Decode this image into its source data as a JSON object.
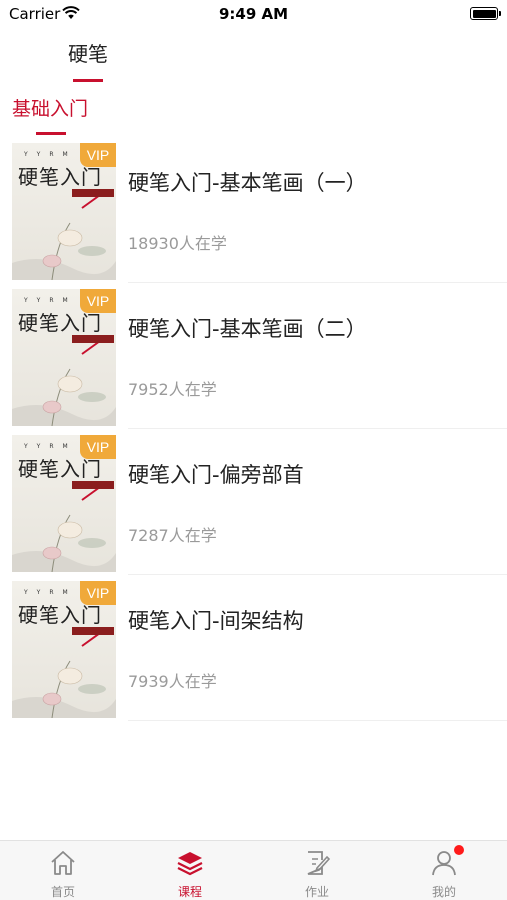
{
  "status_bar": {
    "carrier": "Carrier",
    "time": "9:49 AM"
  },
  "top_tabs": [
    {
      "label": "硬笔",
      "active": true
    }
  ],
  "sub_tabs": [
    {
      "label": "基础入门",
      "active": true
    }
  ],
  "courses": [
    {
      "title": "硬笔入门-基本笔画（一）",
      "learners": "18930人在学",
      "badge": "VIP",
      "cover_title": "硬笔入门"
    },
    {
      "title": "硬笔入门-基本笔画（二）",
      "learners": "7952人在学",
      "badge": "VIP",
      "cover_title": "硬笔入门"
    },
    {
      "title": "硬笔入门-偏旁部首",
      "learners": "7287人在学",
      "badge": "VIP",
      "cover_title": "硬笔入门"
    },
    {
      "title": "硬笔入门-间架结构",
      "learners": "7939人在学",
      "badge": "VIP",
      "cover_title": "硬笔入门"
    }
  ],
  "tab_bar": [
    {
      "label": "首页",
      "icon": "home-icon",
      "active": false
    },
    {
      "label": "课程",
      "icon": "stack-icon",
      "active": true
    },
    {
      "label": "作业",
      "icon": "edit-document-icon",
      "active": false
    },
    {
      "label": "我的",
      "icon": "user-icon",
      "active": false,
      "notification": true
    }
  ],
  "colors": {
    "accent": "#c8102e",
    "vip": "#f0a93a",
    "muted_text": "#9a9a9a",
    "notification": "#ff1a1a"
  }
}
